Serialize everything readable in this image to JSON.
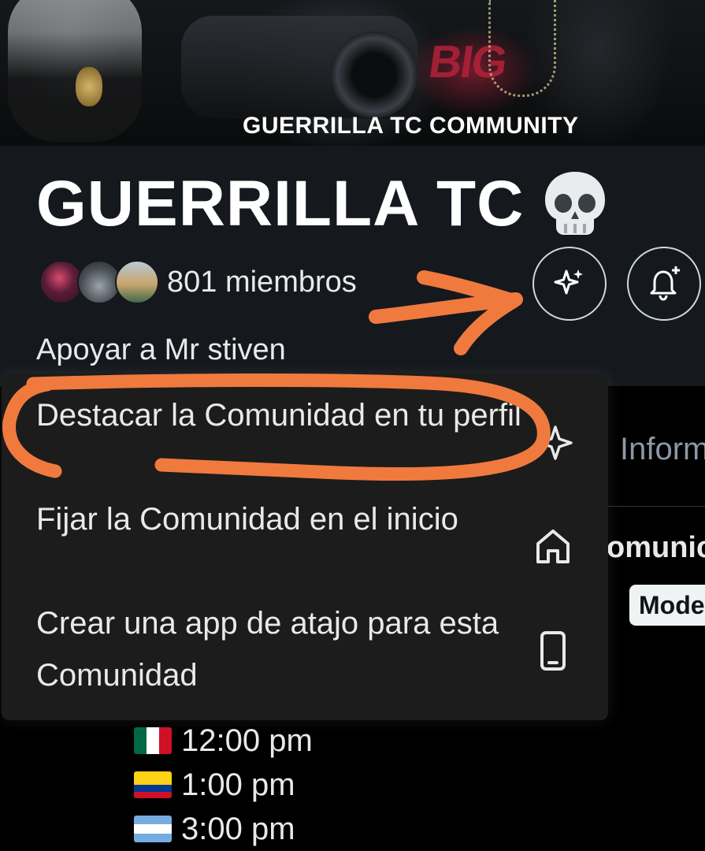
{
  "banner": {
    "caption": "GUERRILLA TC COMMUNITY",
    "logo_text": "BIG"
  },
  "community": {
    "name": "GUERRILLA TC",
    "title_emoji": "skull-emoji",
    "members_label": "801 miembros",
    "support_link": "Apoyar a Mr stiven"
  },
  "actions": {
    "spotlight_icon": "sparkle-icon",
    "notify_icon": "bell-plus-icon"
  },
  "menu": {
    "items": [
      {
        "label": "Destacar la Comunidad en tu perfil",
        "icon": "sparkle-icon"
      },
      {
        "label": "Fijar la Comunidad en el inicio",
        "icon": "home-icon"
      },
      {
        "label": "Crear una app de atajo para esta Comunidad",
        "icon": "phone-icon"
      }
    ]
  },
  "background_content": {
    "tab_partial": "Inform",
    "heading_partial": "omunic",
    "badge_partial": "Moder",
    "times": [
      {
        "flag": "Mexico",
        "time": "12:00 pm"
      },
      {
        "flag": "Colombia",
        "time": "1:00 pm"
      },
      {
        "flag": "Argentina",
        "time": "3:00 pm"
      }
    ]
  },
  "colors": {
    "header_bg": "#15191d",
    "menu_bg": "#1c1c1c",
    "annotation": "#f07a3e",
    "text": "#e7e9ea",
    "muted": "#8b98a5"
  }
}
